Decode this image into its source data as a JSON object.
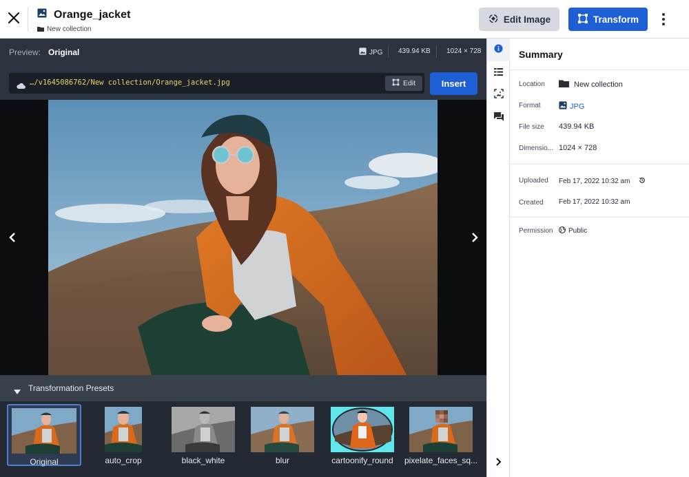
{
  "header": {
    "title": "Orange_jacket",
    "collection": "New collection",
    "edit_image_label": "Edit Image",
    "transform_label": "Transform"
  },
  "preview": {
    "label": "Preview:",
    "value": "Original",
    "format": "JPG",
    "size": "439.94 KB",
    "dimensions": "1024 × 728"
  },
  "url_bar": {
    "path": "…/v1645086762/New collection/Orange_jacket.jpg",
    "edit_label": "Edit",
    "insert_label": "Insert"
  },
  "presets": {
    "title": "Transformation Presets",
    "selected": "Original",
    "items": [
      {
        "label": "Original"
      },
      {
        "label": "auto_crop"
      },
      {
        "label": "black_white"
      },
      {
        "label": "blur"
      },
      {
        "label": "cartoonify_round"
      },
      {
        "label": "pixelate_faces_sq..."
      }
    ]
  },
  "summary": {
    "title": "Summary",
    "location_label": "Location",
    "location_value": "New collection",
    "format_label": "Format",
    "format_value": "JPG",
    "file_size_label": "File size",
    "file_size_value": "439.94 KB",
    "dimensions_label": "Dimensio...",
    "dimensions_value": "1024 × 728",
    "uploaded_label": "Uploaded",
    "uploaded_value": "Feb 17, 2022 10:32 am",
    "created_label": "Created",
    "created_value": "Feb 17, 2022 10:32 am",
    "permission_label": "Permission",
    "permission_value": "Public"
  },
  "rail": [
    "info-icon",
    "metadata-icon",
    "image-analysis-icon",
    "comments-icon"
  ],
  "colors": {
    "accent": "#1e5fd6",
    "dark_panel": "#2c333e",
    "jacket": "#d86a1e"
  }
}
